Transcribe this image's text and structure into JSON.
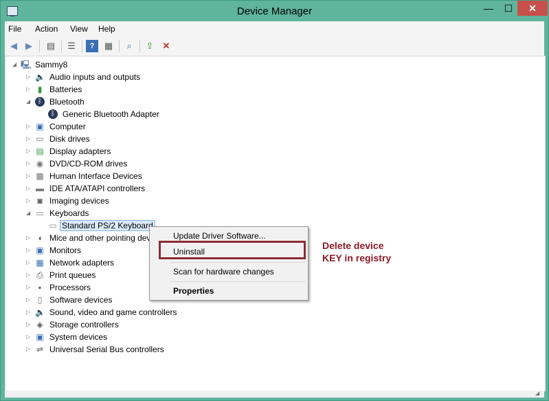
{
  "window": {
    "title": "Device Manager",
    "controls": {
      "minimize": "—",
      "maximize": "☐",
      "close": "✕"
    }
  },
  "menu": [
    "File",
    "Action",
    "View",
    "Help"
  ],
  "toolbar": {
    "buttons": [
      "back-icon",
      "forward-icon",
      "properties-view-icon",
      "list-view-icon",
      "help-icon",
      "details-view-icon",
      "scan-hardware-icon",
      "update-driver-icon",
      "uninstall-icon"
    ]
  },
  "tree": {
    "root": "Sammy8",
    "nodes": [
      {
        "label": "Audio inputs and outputs",
        "icon": "speaker-icon",
        "expanded": false
      },
      {
        "label": "Batteries",
        "icon": "battery-icon",
        "expanded": false
      },
      {
        "label": "Bluetooth",
        "icon": "bluetooth-icon",
        "expanded": true
      },
      {
        "label": "Generic Bluetooth Adapter",
        "icon": "bluetooth-icon",
        "child": true
      },
      {
        "label": "Computer",
        "icon": "computer-icon",
        "expanded": false
      },
      {
        "label": "Disk drives",
        "icon": "disk-icon",
        "expanded": false
      },
      {
        "label": "Display adapters",
        "icon": "display-icon",
        "expanded": false
      },
      {
        "label": "DVD/CD-ROM drives",
        "icon": "dvd-icon",
        "expanded": false
      },
      {
        "label": "Human Interface Devices",
        "icon": "hid-icon",
        "expanded": false
      },
      {
        "label": "IDE ATA/ATAPI controllers",
        "icon": "ide-icon",
        "expanded": false
      },
      {
        "label": "Imaging devices",
        "icon": "camera-icon",
        "expanded": false
      },
      {
        "label": "Keyboards",
        "icon": "keyboard-icon",
        "expanded": true
      },
      {
        "label": "Standard PS/2 Keyboard",
        "icon": "keyboard-icon",
        "child": true,
        "selected": true
      },
      {
        "label": "Mice and other pointing dev",
        "icon": "mouse-icon",
        "expanded": false
      },
      {
        "label": "Monitors",
        "icon": "monitor-icon",
        "expanded": false
      },
      {
        "label": "Network adapters",
        "icon": "network-icon",
        "expanded": false
      },
      {
        "label": "Print queues",
        "icon": "printer-icon",
        "expanded": false
      },
      {
        "label": "Processors",
        "icon": "processor-icon",
        "expanded": false
      },
      {
        "label": "Software devices",
        "icon": "software-icon",
        "expanded": false
      },
      {
        "label": "Sound, video and game controllers",
        "icon": "sound-icon",
        "expanded": false
      },
      {
        "label": "Storage controllers",
        "icon": "storage-icon",
        "expanded": false
      },
      {
        "label": "System devices",
        "icon": "system-icon",
        "expanded": false
      },
      {
        "label": "Universal Serial Bus controllers",
        "icon": "usb-icon",
        "expanded": false
      }
    ]
  },
  "context_menu": {
    "items": [
      "Update Driver Software...",
      "Uninstall",
      "Scan for hardware changes",
      "Properties"
    ]
  },
  "annotation": {
    "line1": "Delete device",
    "line2": "KEY in registry",
    "color": "#8b1a26"
  },
  "colors": {
    "window_frame": "#5fb49b",
    "close_button": "#c7504a",
    "selection": "#dbeaf9",
    "highlight_box": "#8b2c35"
  }
}
